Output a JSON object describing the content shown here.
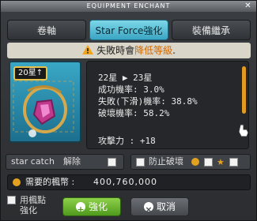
{
  "window": {
    "title": "EQUIPMENT ENCHANT",
    "close_icon": "close-icon"
  },
  "tabs": [
    {
      "label": "卷軸",
      "active": false
    },
    {
      "label": "Star Force強化",
      "active": true
    },
    {
      "label": "裝備繼承",
      "active": false
    }
  ],
  "warning": {
    "text_prefix": "失敗時會",
    "text_highlight": "降低等級",
    "text_suffix": ".",
    "icon": "warning-icon",
    "highlight_color": "#d46a00"
  },
  "item": {
    "star_badge": "20星↑",
    "icon": "amulet-icon"
  },
  "stats": {
    "star_change": "22星 ▶ 23星",
    "success_rate": "成功機率: 3.0%",
    "fail_rate": "失敗(下滑)機率: 38.8%",
    "destroy_rate": "破壞機率: 58.2%",
    "attack": "攻擊力 : +18"
  },
  "options": {
    "star_catch_label": "star catch",
    "star_catch_action": "解除",
    "protect_label": "防止破壞"
  },
  "cost": {
    "label": "需要的楓幣 :",
    "value": "400,760,000"
  },
  "buttons": {
    "use_points": "用楓點強化",
    "enhance": "強化",
    "cancel": "取消"
  },
  "colors": {
    "accent_tab": "#3aa5c4",
    "enhance_button": "#5fad26",
    "scrollbar": "#e29b1f"
  }
}
